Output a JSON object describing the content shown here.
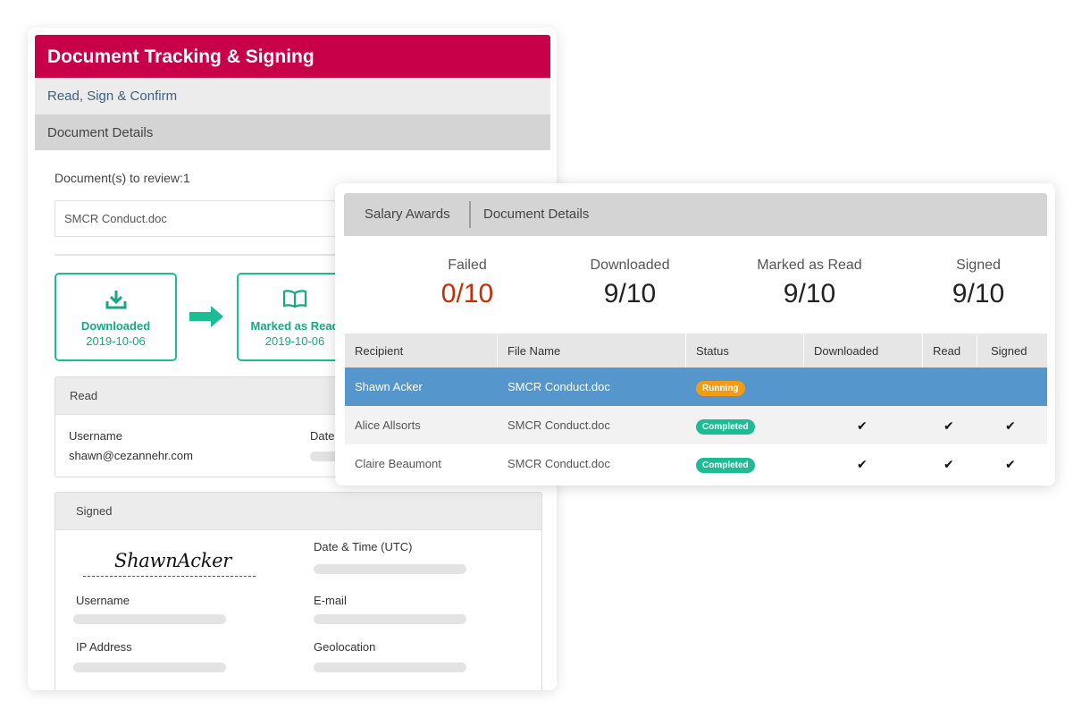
{
  "left_card": {
    "title": "Document Tracking & Signing",
    "subtitle": "Read, Sign & Confirm",
    "section": "Document Details",
    "review_label": "Document(s) to review:1",
    "file_name": "SMCR Conduct.doc",
    "steps": [
      {
        "label": "Downloaded",
        "date": "2019-10-06",
        "icon": "download-icon"
      },
      {
        "label": "Marked as Read",
        "date": "2019-10-06",
        "icon": "book-icon"
      }
    ],
    "read_panel": {
      "title": "Read",
      "username_label": "Username",
      "username_value": "shawn@cezannehr.com",
      "date_label": "Date"
    },
    "signed_panel": {
      "title": "Signed",
      "signature": "ShawnAcker",
      "datetime_label": "Date & Time (UTC)",
      "username_label": "Username",
      "email_label": "E-mail",
      "ip_label": "IP Address",
      "geo_label": "Geolocation"
    }
  },
  "right_card": {
    "tabs": [
      "Salary Awards",
      "Document Details"
    ],
    "stats": [
      {
        "label": "Failed",
        "value": "0/10"
      },
      {
        "label": "Downloaded",
        "value": "9/10"
      },
      {
        "label": "Marked as Read",
        "value": "9/10"
      },
      {
        "label": "Signed",
        "value": "9/10"
      }
    ],
    "columns": [
      "Recipient",
      "File Name",
      "Status",
      "Downloaded",
      "Read",
      "Signed"
    ],
    "rows": [
      {
        "recipient": "Shawn Acker",
        "file": "SMCR Conduct.doc",
        "status": "Running",
        "downloaded": false,
        "read": false,
        "signed": false
      },
      {
        "recipient": "Alice Allsorts",
        "file": "SMCR Conduct.doc",
        "status": "Completed",
        "downloaded": true,
        "read": true,
        "signed": true
      },
      {
        "recipient": "Claire Beaumont",
        "file": "SMCR Conduct.doc",
        "status": "Completed",
        "downloaded": true,
        "read": true,
        "signed": true
      }
    ]
  },
  "colors": {
    "brand": "#c8004a",
    "accent_green": "#1ebc95",
    "highlight_row": "#5597cd",
    "running": "#f39c12",
    "failed_text": "#c62d06"
  },
  "check_glyph": "✔"
}
